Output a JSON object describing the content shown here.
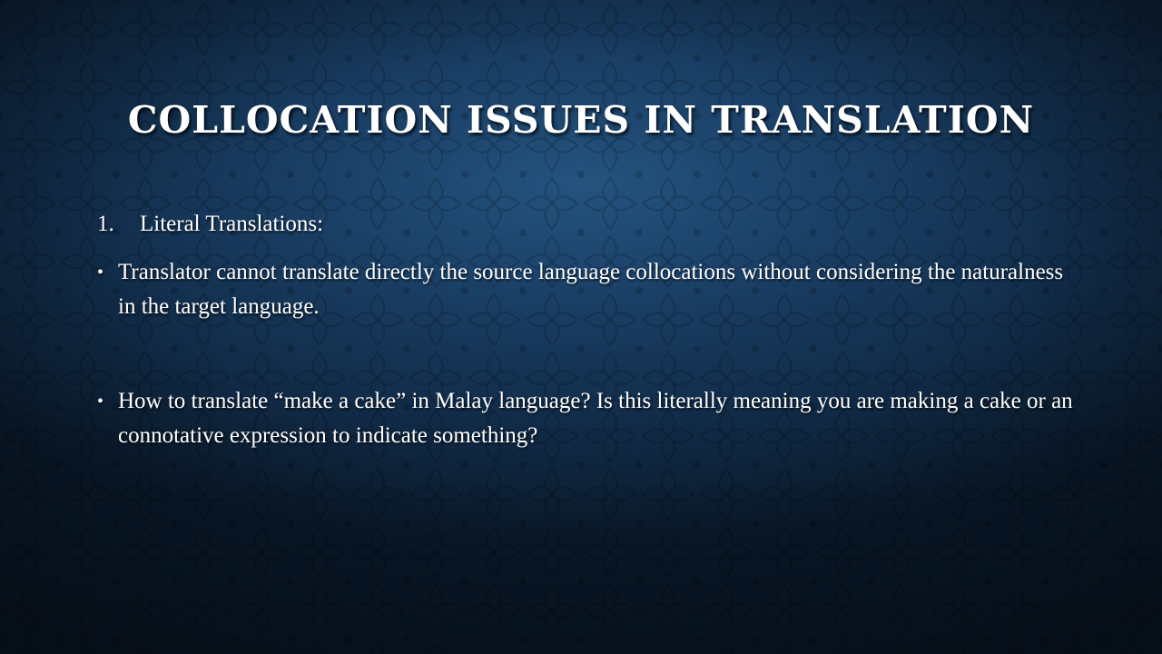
{
  "slide": {
    "title": "COLLOCATION ISSUES IN TRANSLATION",
    "colors": {
      "background_center": "#24537e",
      "background_edge": "#0a1a2c",
      "text": "#ffffff"
    },
    "items": [
      {
        "marker": "1.",
        "text": "Literal Translations:"
      },
      {
        "marker": "•",
        "text": "Translator cannot translate directly the source language collocations without considering the naturalness in the target language."
      },
      {
        "marker": "•",
        "text": "How to translate “make a cake” in Malay language? Is this literally meaning you are making a cake or an connotative expression to indicate something?"
      }
    ]
  }
}
